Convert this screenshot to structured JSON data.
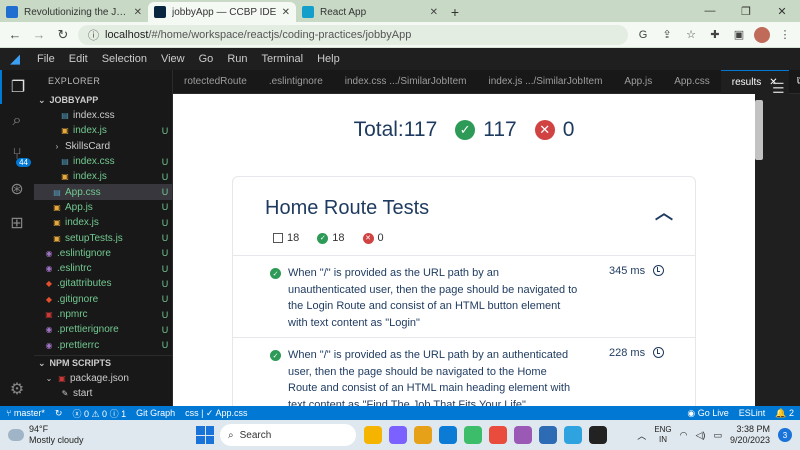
{
  "browser": {
    "tabs": [
      {
        "label": "Revolutionizing the Job Market |",
        "color": "#1f6fd1"
      },
      {
        "label": "jobbyApp — CCBP IDE",
        "color": "#0a2540"
      },
      {
        "label": "React App",
        "color": "#149eca"
      }
    ],
    "new_tab": "+",
    "url": "localhost/#/home/workspace/reactjs/coding-practices/jobbyApp",
    "url_host": "localhost",
    "url_rest": "/#/home/workspace/reactjs/coding-practices/jobbyApp"
  },
  "menu": [
    "File",
    "Edit",
    "Selection",
    "View",
    "Go",
    "Run",
    "Terminal",
    "Help"
  ],
  "activity": {
    "scm_badge": "44"
  },
  "explorer": {
    "title": "EXPLORER",
    "project": "JOBBYAPP",
    "files": [
      {
        "name": "index.css",
        "kind": "css",
        "status": "",
        "indent": 26
      },
      {
        "name": "index.js",
        "kind": "js",
        "status": "U",
        "indent": 26
      },
      {
        "name": "SkillsCard",
        "kind": "folder",
        "status": "",
        "indent": 18
      },
      {
        "name": "index.css",
        "kind": "css",
        "status": "U",
        "indent": 26
      },
      {
        "name": "index.js",
        "kind": "js",
        "status": "U",
        "indent": 26
      },
      {
        "name": "App.css",
        "kind": "css",
        "status": "U",
        "indent": 18,
        "selected": true
      },
      {
        "name": "App.js",
        "kind": "js",
        "status": "U",
        "indent": 18
      },
      {
        "name": "index.js",
        "kind": "js",
        "status": "U",
        "indent": 18
      },
      {
        "name": "setupTests.js",
        "kind": "js",
        "status": "U",
        "indent": 18
      },
      {
        "name": ".eslintignore",
        "kind": "lint",
        "status": "U",
        "indent": 10
      },
      {
        "name": ".eslintrc",
        "kind": "lint",
        "status": "U",
        "indent": 10
      },
      {
        "name": ".gitattributes",
        "kind": "git",
        "status": "U",
        "indent": 10
      },
      {
        "name": ".gitignore",
        "kind": "git",
        "status": "U",
        "indent": 10
      },
      {
        "name": ".npmrc",
        "kind": "npm",
        "status": "U",
        "indent": 10
      },
      {
        "name": ".prettierignore",
        "kind": "lint",
        "status": "U",
        "indent": 10
      },
      {
        "name": ".prettierrc",
        "kind": "lint",
        "status": "U",
        "indent": 10
      }
    ],
    "npm_section": "NPM SCRIPTS",
    "npm_items": [
      {
        "name": "package.json",
        "indent": 10
      },
      {
        "name": "start",
        "indent": 26
      }
    ]
  },
  "editor_tabs": [
    {
      "label": "rotectedRoute",
      "active": false
    },
    {
      "label": ".eslintignore",
      "active": false
    },
    {
      "label": "index.css .../SimilarJobItem",
      "active": false
    },
    {
      "label": "index.js .../SimilarJobItem",
      "active": false
    },
    {
      "label": "App.js",
      "active": false
    },
    {
      "label": "App.css",
      "active": false
    },
    {
      "label": "results",
      "active": true
    }
  ],
  "results": {
    "total_label": "Total:117",
    "passed": "117",
    "failed": "0",
    "suite": {
      "title": "Home Route Tests",
      "total": "18",
      "passed": "18",
      "failed": "0",
      "tests": [
        {
          "text": "When \"/\" is provided as the URL path by an unauthenticated user, then the page should be navigated to the Login Route and consist of an HTML button element with text content as \"Login\"",
          "time": "345 ms"
        },
        {
          "text": "When \"/\" is provided as the URL path by an authenticated user, then the page should be navigated to the Home Route and consist of an HTML main heading element with text content as \"Find The Job That Fits Your Life\"",
          "time": "228 ms"
        }
      ]
    }
  },
  "statusbar": {
    "branch": "master*",
    "problems": "0 ⚠ 0 ⓘ 1",
    "git_graph": "Git Graph",
    "lang": "css | ✓ App.css",
    "go_live": "Go Live",
    "eslint": "ESLint",
    "bell": "2"
  },
  "taskbar": {
    "temp": "94°F",
    "weather": "Mostly cloudy",
    "search": "Search",
    "lang_top": "ENG",
    "lang_bottom": "IN",
    "time": "3:38 PM",
    "date": "9/20/2023",
    "notif": "3",
    "apps": [
      "#f4b400",
      "#7b61ff",
      "#e6a118",
      "#0b7bd6",
      "#3bbd69",
      "#e94c3c",
      "#9b59b6",
      "#2d6bb5",
      "#2fa2e0",
      "#222"
    ]
  }
}
